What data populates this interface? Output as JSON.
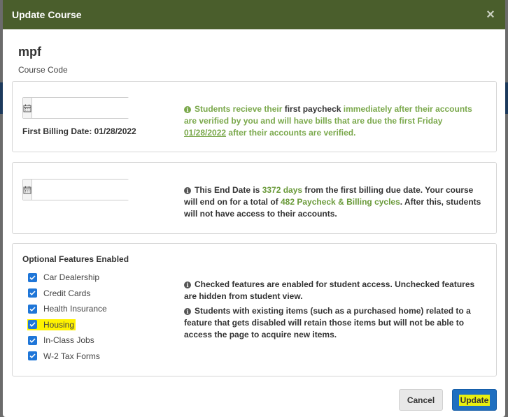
{
  "modal": {
    "title": "Update Course",
    "close_icon": "×"
  },
  "course": {
    "name": "mpf",
    "subtitle": "Course Code"
  },
  "first_billing": {
    "date_value": "",
    "label": "First Billing Date: 01/28/2022",
    "info": {
      "p1": "Students recieve their ",
      "b1": "first paycheck",
      "p2": " immediately after their accounts are verified by you and will have bills that are due the first Friday ",
      "date": "01/28/2022",
      "p3": " after their accounts are verified."
    }
  },
  "end_date": {
    "date_value": "",
    "info": {
      "p1": "This End Date is ",
      "days": "3372 days",
      "p2": " from the first billing due date. Your course will end on for a total of ",
      "cycles": "482 Paycheck & Billing cycles",
      "p3": ". After this, students will not have access to their accounts."
    }
  },
  "features": {
    "title": "Optional Features Enabled",
    "items": [
      {
        "label": "Car Dealership",
        "checked": true
      },
      {
        "label": "Credit Cards",
        "checked": true
      },
      {
        "label": "Health Insurance",
        "checked": true
      },
      {
        "label": "Housing",
        "checked": true
      },
      {
        "label": "In-Class Jobs",
        "checked": true
      },
      {
        "label": "W-2 Tax Forms",
        "checked": true
      }
    ],
    "info1": "Checked features are enabled for student access. Unchecked features are hidden from student view.",
    "info2": "Students with existing items (such as a purchased home) related to a feature that gets disabled will retain those items but will not be able to access the page to acquire new items."
  },
  "buttons": {
    "cancel": "Cancel",
    "update": "Update"
  },
  "colors": {
    "header": "#4a5e2c",
    "accent_green": "#7aa84b",
    "primary": "#1f6fc0",
    "checkbox": "#1f76d8",
    "highlight": "#fff200"
  }
}
